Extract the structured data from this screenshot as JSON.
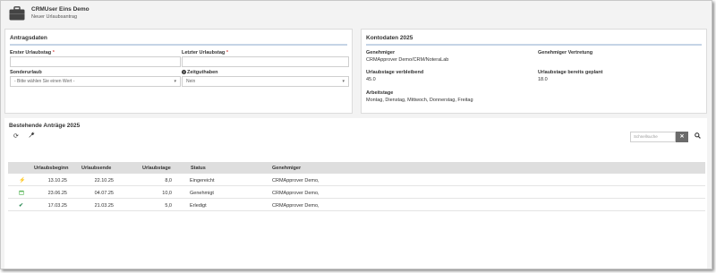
{
  "header": {
    "title": "CRMUser Eins Demo",
    "subtitle": "Neuer Urlaubsantrag"
  },
  "antrag": {
    "title": "Antragsdaten",
    "first_day_label": "Erster Urlaubstag",
    "last_day_label": "Letzter Urlaubstag",
    "required_mark": "*",
    "first_day_value": "",
    "last_day_value": "",
    "special_label": "Sonderurlaub",
    "special_value": "- Bitte wählen Sie einen Wert -",
    "overtime_label": "Zeitguthaben",
    "overtime_help_icon": "question-circle-icon",
    "overtime_value": "Nein"
  },
  "konto": {
    "title": "Kontodaten 2025",
    "approver_label": "Genehmiger",
    "approver_value": "CRMApprover Demo/CRM/NoteraLab",
    "deputy_label": "Genehmiger Vertretung",
    "deputy_value": "",
    "remaining_label": "Urlaubstage verbleibend",
    "remaining_value": "45.0",
    "planned_label": "Urlaubstage bereits geplant",
    "planned_value": "18.0",
    "workdays_label": "Arbeitstage",
    "workdays_value": "Montag, Dienstag, Mittwoch, Donnerstag, Freitag"
  },
  "antraege": {
    "title": "Bestehende Anträge 2025",
    "refresh_icon": "refresh-icon",
    "settings_icon": "wrench-icon",
    "search_placeholder": "Schnellsuche",
    "clear_icon": "close-icon",
    "search_icon": "search-icon",
    "columns": [
      "Urlaubsbeginn",
      "Urlaubsende",
      "Urlaubstage",
      "Status",
      "Genehmiger"
    ],
    "rows": [
      {
        "icon": "bolt-icon",
        "start": "13.10.25",
        "end": "22.10.25",
        "days": "8,0",
        "status": "Eingereicht",
        "approver": "CRMApprover Demo,"
      },
      {
        "icon": "calendar-icon",
        "start": "23.06.25",
        "end": "04.07.25",
        "days": "10,0",
        "status": "Genehmigt",
        "approver": "CRMApprover Demo,"
      },
      {
        "icon": "check-icon",
        "start": "17.03.25",
        "end": "21.03.25",
        "days": "5,0",
        "status": "Erledigt",
        "approver": "CRMApprover Demo,"
      }
    ]
  },
  "colors": {
    "accent_rule": "#c5d4e6",
    "bolt": "#f0ad4e",
    "calendar": "#5cb85c",
    "check": "#2e8b57"
  }
}
